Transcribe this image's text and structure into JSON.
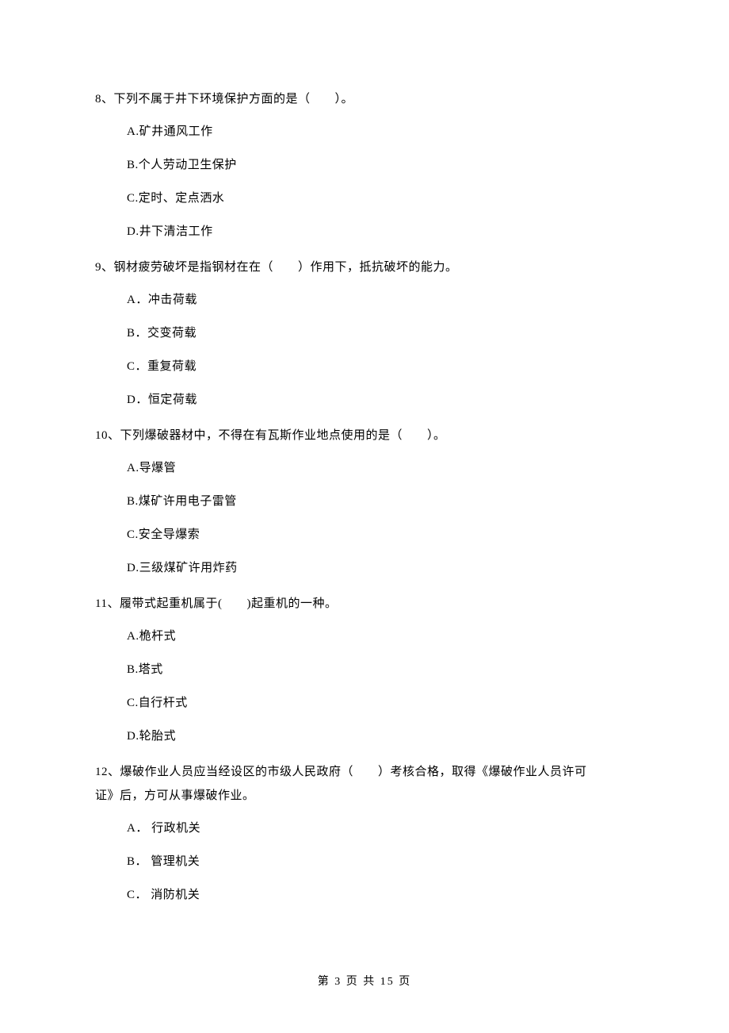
{
  "questions": [
    {
      "number": "8、",
      "stem": "下列不属于井下环境保护方面的是（　　）。",
      "options": [
        "A.矿井通风工作",
        "B.个人劳动卫生保护",
        "C.定时、定点洒水",
        "D.井下清洁工作"
      ]
    },
    {
      "number": "9、",
      "stem": "钢材疲劳破坏是指钢材在在（　　）作用下，抵抗破坏的能力。",
      "options": [
        "A．冲击荷载",
        "B．交变荷载",
        "C．重复荷载",
        "D．恒定荷载"
      ]
    },
    {
      "number": "10、",
      "stem": "下列爆破器材中，不得在有瓦斯作业地点使用的是（　　）。",
      "options": [
        "A.导爆管",
        "B.煤矿许用电子雷管",
        "C.安全导爆索",
        "D.三级煤矿许用炸药"
      ]
    },
    {
      "number": "11、",
      "stem": "履带式起重机属于(　　)起重机的一种。",
      "options": [
        "A.桅杆式",
        "B.塔式",
        "C.自行杆式",
        "D.轮胎式"
      ]
    },
    {
      "number": "12、",
      "stem_line1": "爆破作业人员应当经设区的市级人民政府（　　）考核合格，取得《爆破作业人员许可",
      "stem_line2": "证》后，方可从事爆破作业。",
      "options": [
        "A． 行政机关",
        "B． 管理机关",
        "C． 消防机关"
      ]
    }
  ],
  "footer": "第 3 页 共 15 页"
}
